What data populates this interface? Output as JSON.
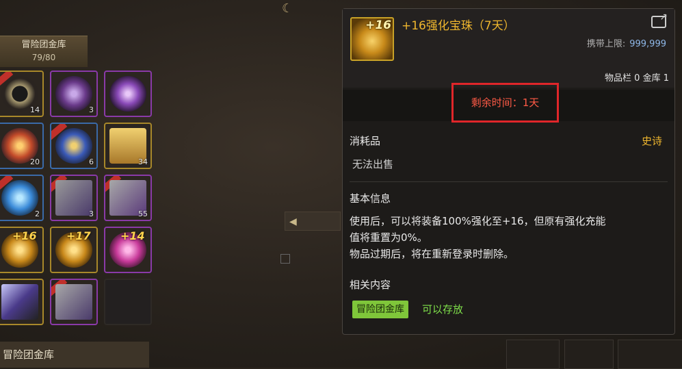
{
  "left_panel": {
    "storage_title": "冒险团金库",
    "storage_count": "79/80",
    "bottom_tab": "冒险团金库",
    "slots": [
      {
        "q": "14",
        "plus": ""
      },
      {
        "q": "3",
        "plus": ""
      },
      {
        "q": "",
        "plus": ""
      },
      {
        "q": "20",
        "plus": ""
      },
      {
        "q": "6",
        "plus": ""
      },
      {
        "q": "34",
        "plus": ""
      },
      {
        "q": "2",
        "plus": ""
      },
      {
        "q": "3",
        "plus": ""
      },
      {
        "q": "55",
        "plus": ""
      },
      {
        "q": "",
        "plus": "+16"
      },
      {
        "q": "",
        "plus": "+17"
      },
      {
        "q": "",
        "plus": "+14"
      },
      {
        "q": "",
        "plus": ""
      },
      {
        "q": "",
        "plus": ""
      },
      {
        "q": "",
        "plus": ""
      }
    ]
  },
  "tooltip": {
    "item_icon_label": "+16",
    "title": "+16强化宝珠（7天）",
    "carry_limit_label": "携带上限:",
    "carry_limit_value": "999,999",
    "stock": "物品栏 0 金库 1",
    "remaining_time": "剩余时间：1天",
    "category": "消耗品",
    "rarity": "史诗",
    "no_sell": "无法出售",
    "basic_info_label": "基本信息",
    "desc_line1": "使用后，可以将装备100%强化至+16，但原有强化充能",
    "desc_line2": "值将重置为0%。",
    "desc_line3": "物品过期后，将在重新登录时删除。",
    "related_label": "相关内容",
    "storage_tag": "冒险团金库",
    "can_store": "可以存放"
  },
  "colors": {
    "title_gold": "#f0b72e",
    "highlight_red": "#e0262a",
    "green_tag": "#7fc63a"
  }
}
